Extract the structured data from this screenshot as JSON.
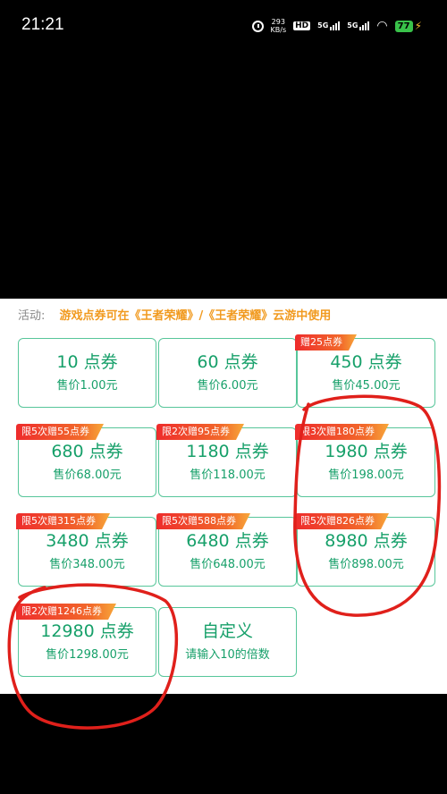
{
  "status_bar": {
    "time": "21:21",
    "net_speed_value": "293",
    "net_speed_unit": "KB/s",
    "hd_label": "HD",
    "signal_1_label": "5G",
    "signal_2_label": "5G",
    "battery": "77"
  },
  "activity": {
    "label": "活动:",
    "text": "游戏点券可在《王者荣耀》/《王者荣耀》云游中使用"
  },
  "cards": [
    {
      "amount": "10 点券",
      "price": "售价1.00元",
      "tag": ""
    },
    {
      "amount": "60 点券",
      "price": "售价6.00元",
      "tag": ""
    },
    {
      "amount": "450 点券",
      "price": "售价45.00元",
      "tag": "赠25点券"
    },
    {
      "amount": "680 点券",
      "price": "售价68.00元",
      "tag": "限5次赠55点券"
    },
    {
      "amount": "1180 点券",
      "price": "售价118.00元",
      "tag": "限2次赠95点券"
    },
    {
      "amount": "1980 点券",
      "price": "售价198.00元",
      "tag": "限3次赠180点券"
    },
    {
      "amount": "3480 点券",
      "price": "售价348.00元",
      "tag": "限5次赠315点券"
    },
    {
      "amount": "6480 点券",
      "price": "售价648.00元",
      "tag": "限5次赠588点券"
    },
    {
      "amount": "8980 点券",
      "price": "售价898.00元",
      "tag": "限5次赠826点券"
    },
    {
      "amount": "12980 点券",
      "price": "售价1298.00元",
      "tag": "限2次赠1246点券"
    },
    {
      "amount": "自定义",
      "price": "请输入10的倍数",
      "tag": ""
    }
  ],
  "colors": {
    "accent_green": "#17a06a",
    "card_border": "#57c69a",
    "activity_orange": "#f19a1f",
    "tag_red": "#ee2c2c",
    "annotation_red": "#e0201b"
  }
}
